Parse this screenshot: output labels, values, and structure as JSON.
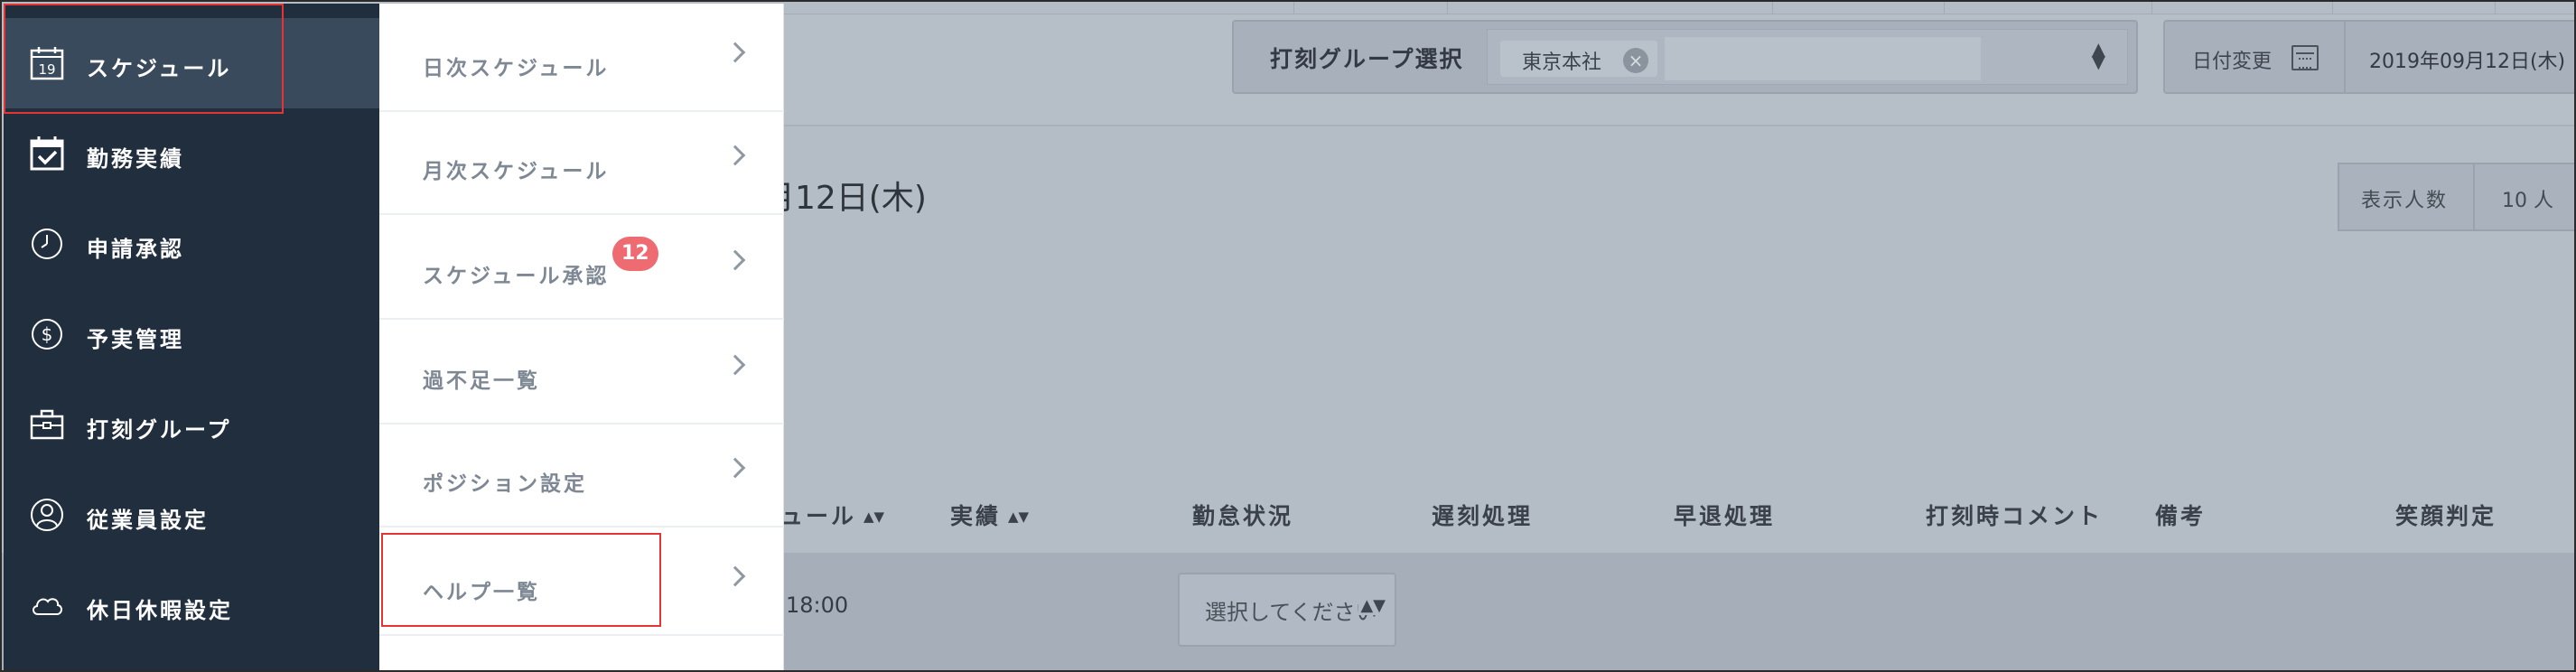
{
  "sidebar": {
    "items": [
      {
        "label": "スケジュール",
        "icon": "calendar-19-icon",
        "icon_text": "19",
        "active": true,
        "highlighted": true
      },
      {
        "label": "勤務実績",
        "icon": "calendar-check-icon"
      },
      {
        "label": "申請承認",
        "icon": "clock-icon"
      },
      {
        "label": "予実管理",
        "icon": "dollar-icon"
      },
      {
        "label": "打刻グループ",
        "icon": "briefcase-icon"
      },
      {
        "label": "従業員設定",
        "icon": "user-icon"
      },
      {
        "label": "休日休暇設定",
        "icon": "cloud-icon"
      }
    ]
  },
  "submenu": {
    "items": [
      {
        "label": "日次スケジュール"
      },
      {
        "label": "月次スケジュール"
      },
      {
        "label": "スケジュール承認",
        "badge": "12"
      },
      {
        "label": "過不足一覧"
      },
      {
        "label": "ポジション設定"
      },
      {
        "label": "ヘルプ一覧",
        "highlighted": true
      }
    ]
  },
  "toolbar": {
    "group_label": "打刻グループ選択",
    "selected_tag": "東京本社",
    "tag_remove": "×",
    "date_change_label": "日付変更",
    "date_value": "2019年09月12日(木)"
  },
  "main": {
    "date_heading": "月12日(木)",
    "display_count_label": "表示人数",
    "display_count_value": "10 人"
  },
  "table": {
    "headers": [
      "ュール",
      "実績",
      "勤怠状況",
      "遅刻処理",
      "早退処理",
      "打刻時コメント",
      "備考",
      "笑顔判定"
    ],
    "row": {
      "time": "18:00",
      "status_placeholder": "選択してください"
    }
  },
  "colors": {
    "sidebar_bg": "#202e3d",
    "sidebar_active": "#3a4a5d",
    "overlay_bg": "#b4bcc5",
    "badge": "#ee6b72",
    "highlight": "#e53434"
  }
}
